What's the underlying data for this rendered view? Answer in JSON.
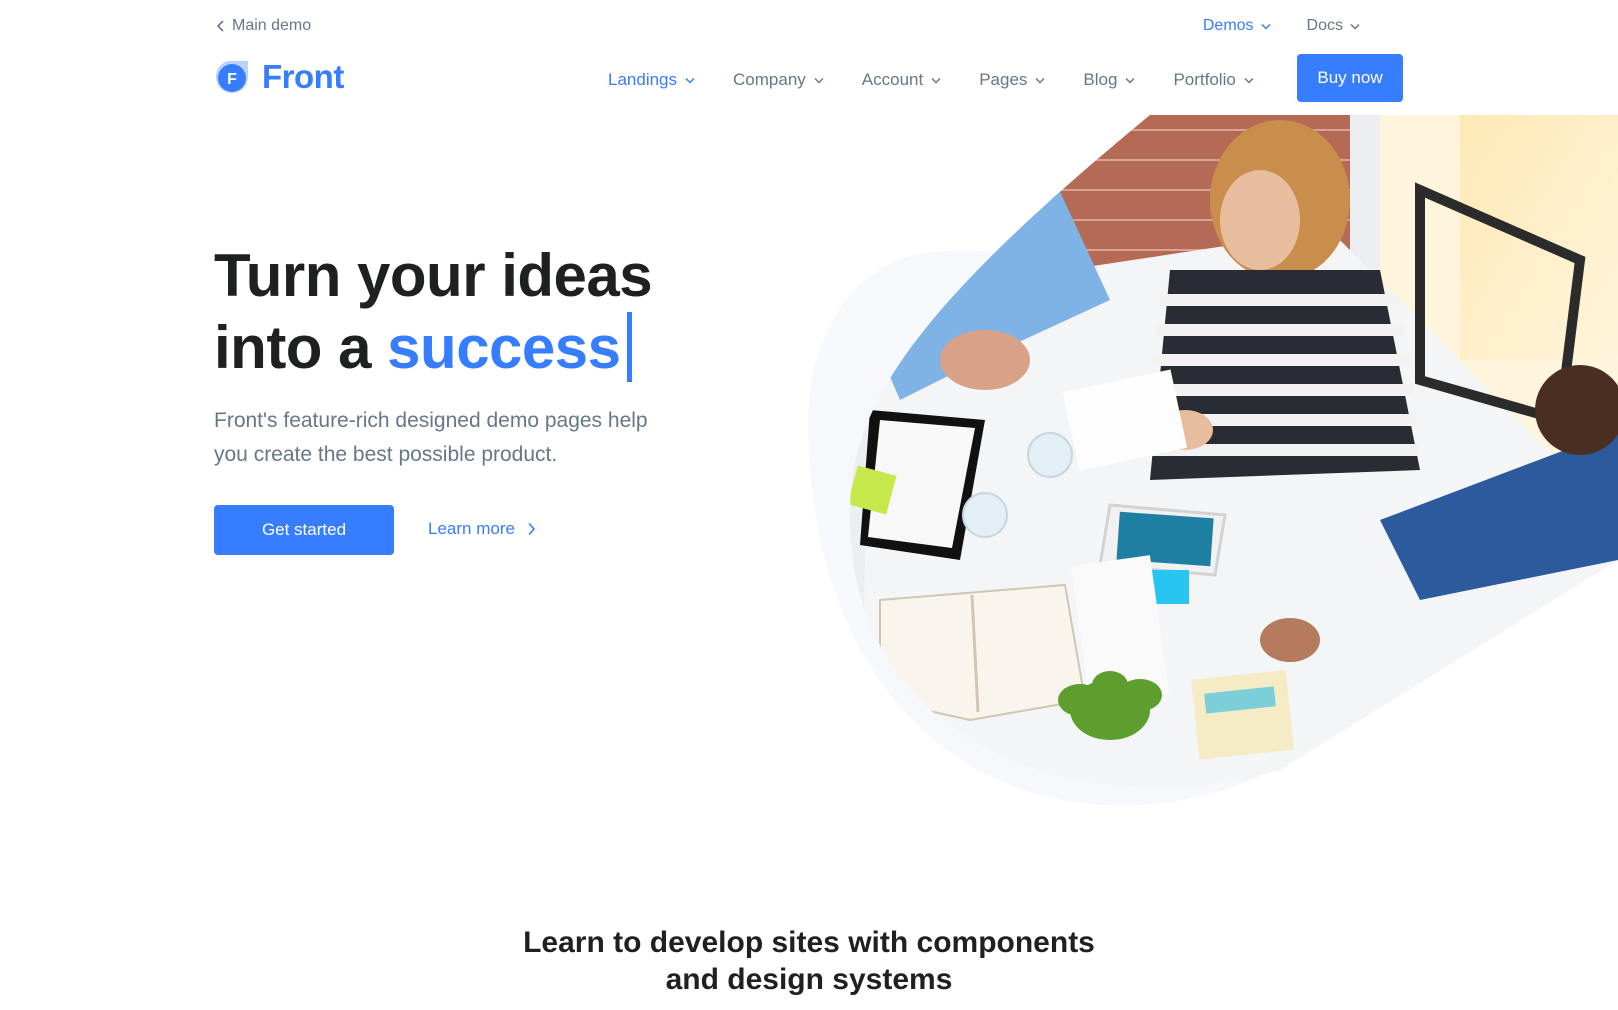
{
  "topbar": {
    "back_label": "Main demo",
    "links": [
      {
        "label": "Demos",
        "active": true
      },
      {
        "label": "Docs",
        "active": false
      }
    ]
  },
  "navbar": {
    "logo_text": "Front",
    "logo_letter": "F",
    "menu": [
      {
        "label": "Landings",
        "active": true
      },
      {
        "label": "Company",
        "active": false
      },
      {
        "label": "Account",
        "active": false
      },
      {
        "label": "Pages",
        "active": false
      },
      {
        "label": "Blog",
        "active": false
      },
      {
        "label": "Portfolio",
        "active": false
      }
    ],
    "buy_label": "Buy now"
  },
  "hero": {
    "title_line1": "Turn your ideas",
    "title_line2_prefix": "into a",
    "title_highlight": "success",
    "subtitle": "Front's feature-rich designed demo pages help you create the best possible product.",
    "primary_button": "Get started",
    "secondary_link": "Learn more"
  },
  "section": {
    "title_line1": "Learn to develop sites with components",
    "title_line2": "and design systems"
  },
  "colors": {
    "primary": "#377dff",
    "text_dark": "#1e2022",
    "text_muted": "#677788",
    "highlight_underline": "#fce3c9"
  }
}
